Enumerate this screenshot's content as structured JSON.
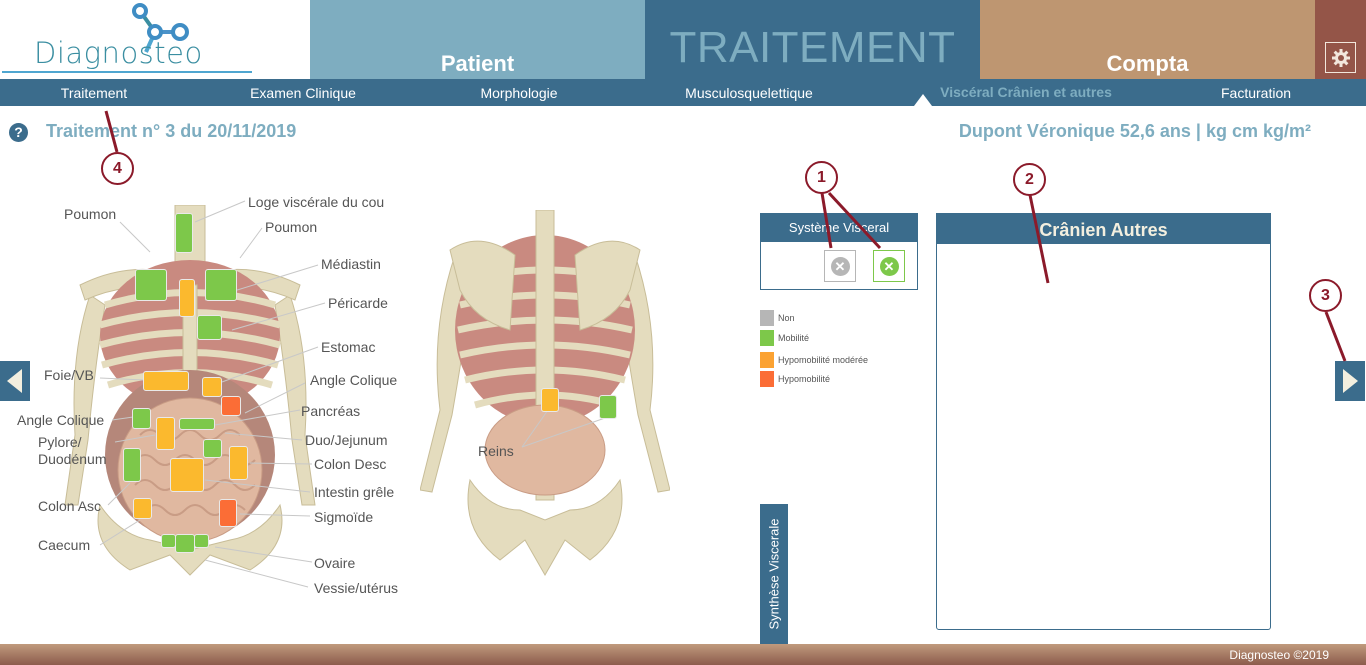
{
  "app": {
    "logo_text": "Diagnosteo",
    "footer": "Diagnosteo ©2019"
  },
  "top_tabs": {
    "patient": "Patient",
    "traitement": "TRAITEMENT",
    "compta": "Compta",
    "settings_icon": "gear-icon"
  },
  "subnav": {
    "items": [
      {
        "label": "Traitement",
        "active": false
      },
      {
        "label": "Examen Clinique",
        "active": false
      },
      {
        "label": "Morphologie",
        "active": false
      },
      {
        "label": "Musculosquelettique",
        "active": false
      },
      {
        "label": "Viscéral Crânien et autres",
        "active": true
      },
      {
        "label": "Facturation",
        "active": false
      }
    ]
  },
  "header": {
    "help_icon": "?",
    "title": "Traitement n° 3 du 20/11/2019",
    "patient_info": "Dupont Véronique 52,6 ans |  kg  cm  kg/m²"
  },
  "colors": {
    "non": "#b6b6b6",
    "mobilite": "#7dc84a",
    "hypomobilite_moderee": "#fbb92e",
    "hypomobilite": "#fb6d36",
    "primary": "#3b6c8c"
  },
  "front_labels": [
    "Poumon",
    "Loge viscérale du cou",
    "Poumon",
    "Médiastin",
    "Péricarde",
    "Estomac",
    "Foie/VB",
    "Angle Colique",
    "Angle Colique",
    "Pancréas",
    "Pylore/",
    "Duodénum",
    "Duo/Jejunum",
    "Colon Desc",
    "Intestin grêle",
    "Colon Asc",
    "Sigmoïde",
    "Caecum",
    "Ovaire",
    "Vessie/utérus"
  ],
  "front_organs": [
    {
      "name": "Loge viscérale du cou",
      "status": "mobilite"
    },
    {
      "name": "Poumon droit",
      "status": "mobilite"
    },
    {
      "name": "Poumon gauche",
      "status": "mobilite"
    },
    {
      "name": "Médiastin",
      "status": "hypomobilite_moderee"
    },
    {
      "name": "Péricarde",
      "status": "mobilite"
    },
    {
      "name": "Foie/VB",
      "status": "hypomobilite_moderee"
    },
    {
      "name": "Estomac",
      "status": "hypomobilite_moderee"
    },
    {
      "name": "Angle Colique gauche",
      "status": "hypomobilite"
    },
    {
      "name": "Angle Colique droit",
      "status": "mobilite"
    },
    {
      "name": "Pylore/Duodénum",
      "status": "hypomobilite_moderee"
    },
    {
      "name": "Pancréas",
      "status": "mobilite"
    },
    {
      "name": "Duo/Jejunum",
      "status": "mobilite"
    },
    {
      "name": "Colon Asc",
      "status": "mobilite"
    },
    {
      "name": "Intestin grêle",
      "status": "hypomobilite_moderee"
    },
    {
      "name": "Colon Desc",
      "status": "hypomobilite_moderee"
    },
    {
      "name": "Caecum",
      "status": "hypomobilite_moderee"
    },
    {
      "name": "Sigmoïde",
      "status": "hypomobilite"
    },
    {
      "name": "Ovaire droit",
      "status": "mobilite"
    },
    {
      "name": "Vessie/utérus",
      "status": "mobilite"
    },
    {
      "name": "Ovaire gauche",
      "status": "mobilite"
    }
  ],
  "back_labels": [
    "Reins"
  ],
  "back_organs": [
    {
      "name": "Rein gauche",
      "status": "hypomobilite_moderee"
    },
    {
      "name": "Rein droit",
      "status": "mobilite"
    }
  ],
  "systeme_visceral": {
    "title": "Système Visceral",
    "buttons": [
      {
        "icon": "x-circle-icon",
        "state": "grey"
      },
      {
        "icon": "x-circle-icon",
        "state": "green"
      }
    ]
  },
  "legend": [
    {
      "label": "Non",
      "color": "#b6b6b6"
    },
    {
      "label": "Mobilité",
      "color": "#7dc84a"
    },
    {
      "label": "Hypomobilité modérée",
      "color": "#fbb92e"
    },
    {
      "label": "Hypomobilité",
      "color": "#fb6d36"
    }
  ],
  "cranien_autres": {
    "title": "Crânien Autres",
    "value": ""
  },
  "synthese_tab": "Synthèse Viscerale",
  "callouts": [
    "1",
    "2",
    "3",
    "4"
  ]
}
